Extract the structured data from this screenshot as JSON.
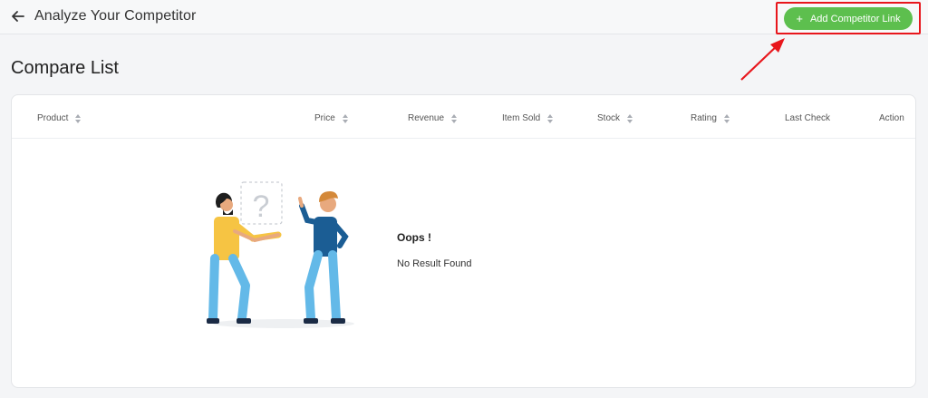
{
  "topbar": {
    "title": "Analyze Your Competitor",
    "back_icon": "arrow-left-icon"
  },
  "actions": {
    "add_label": "Add Competitor Link",
    "add_icon": "plus-icon",
    "accent": "#5dbf4e",
    "highlight_color": "#e8161c"
  },
  "page": {
    "title": "Compare List"
  },
  "table": {
    "columns": [
      {
        "label": "Product",
        "sortable": true
      },
      {
        "label": "Price",
        "sortable": true
      },
      {
        "label": "Revenue",
        "sortable": true
      },
      {
        "label": "Item Sold",
        "sortable": true
      },
      {
        "label": "Stock",
        "sortable": true
      },
      {
        "label": "Rating",
        "sortable": true
      },
      {
        "label": "Last Check",
        "sortable": false
      },
      {
        "label": "Action",
        "sortable": false
      }
    ]
  },
  "empty_state": {
    "title": "Oops !",
    "message": "No Result Found",
    "illustration": "two-people-question-mark"
  }
}
